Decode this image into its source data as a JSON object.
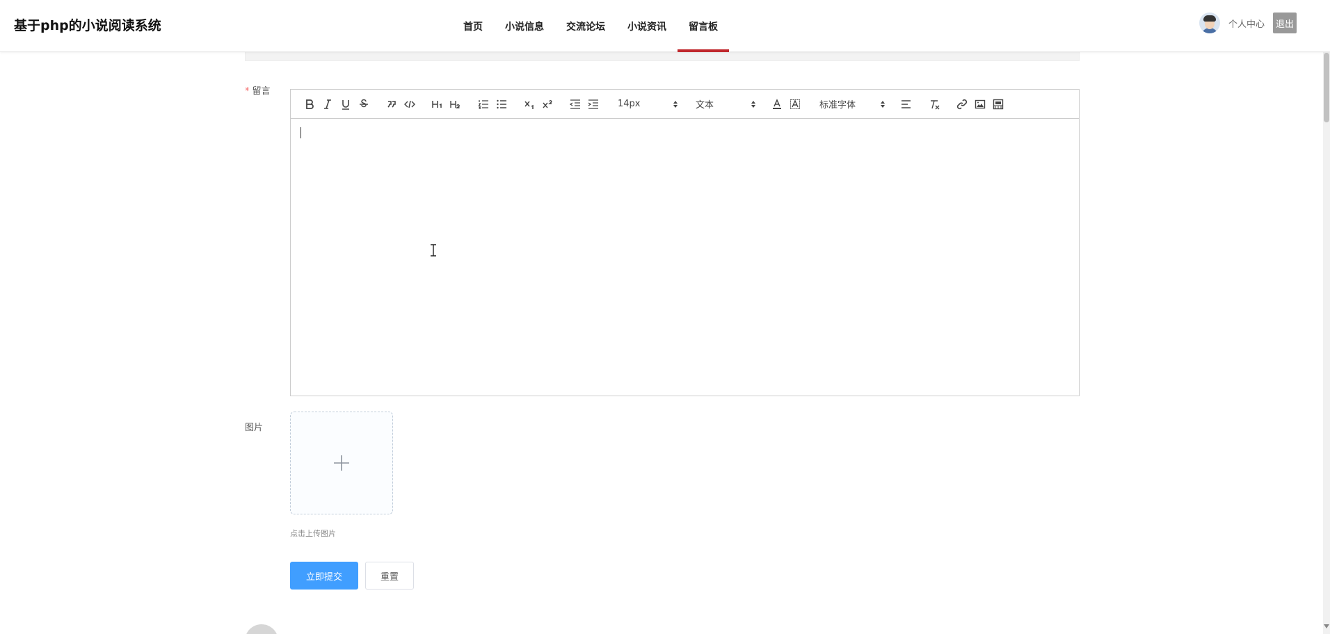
{
  "header": {
    "brand": "基于php的小说阅读系统",
    "nav": [
      {
        "label": "首页"
      },
      {
        "label": "小说信息"
      },
      {
        "label": "交流论坛"
      },
      {
        "label": "小说资讯"
      },
      {
        "label": "留言板",
        "active": true
      }
    ],
    "user_center": "个人中心",
    "logout": "退出"
  },
  "form": {
    "message_label": "留言",
    "required_mark": "*",
    "editor": {
      "font_size": "14px",
      "block_format": "文本",
      "font_family": "标准字体",
      "toolbar_icons": [
        "bold-icon",
        "italic-icon",
        "underline-icon",
        "strike-icon",
        "blockquote-icon",
        "code-block-icon",
        "h1-icon",
        "h2-icon",
        "ordered-list-icon",
        "bullet-list-icon",
        "subscript-icon",
        "superscript-icon",
        "outdent-icon",
        "indent-icon",
        "font-color-icon",
        "background-color-icon",
        "align-icon",
        "clean-format-icon",
        "link-icon",
        "image-icon",
        "video-icon"
      ]
    },
    "image_label": "图片",
    "upload_hint": "点击上传图片",
    "submit": "立即提交",
    "reset": "重置"
  },
  "colors": {
    "accent": "#c0282d",
    "primary": "#409eff",
    "required": "#f56c6c"
  }
}
